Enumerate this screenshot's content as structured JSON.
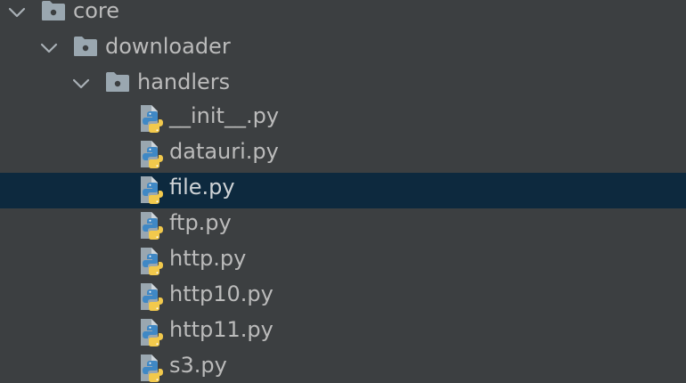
{
  "tree": {
    "folders": [
      {
        "label": "core",
        "icon": "folder-icon",
        "expanded": true
      },
      {
        "label": "downloader",
        "icon": "folder-icon",
        "expanded": true
      },
      {
        "label": "handlers",
        "icon": "folder-icon",
        "expanded": true
      }
    ],
    "files": [
      {
        "label": "__init__.py",
        "icon": "python-file-icon"
      },
      {
        "label": "datauri.py",
        "icon": "python-file-icon"
      },
      {
        "label": "file.py",
        "icon": "python-file-icon",
        "selected": true
      },
      {
        "label": "ftp.py",
        "icon": "python-file-icon"
      },
      {
        "label": "http.py",
        "icon": "python-file-icon"
      },
      {
        "label": "http10.py",
        "icon": "python-file-icon"
      },
      {
        "label": "http11.py",
        "icon": "python-file-icon"
      },
      {
        "label": "s3.py",
        "icon": "python-file-icon"
      }
    ]
  },
  "colors": {
    "background": "#3c3f41",
    "selection": "#0d293e",
    "text": "#bbbbbb",
    "folder": "#9aa7b0",
    "python_blue": "#3f88c5",
    "python_yellow": "#f2c94c"
  }
}
